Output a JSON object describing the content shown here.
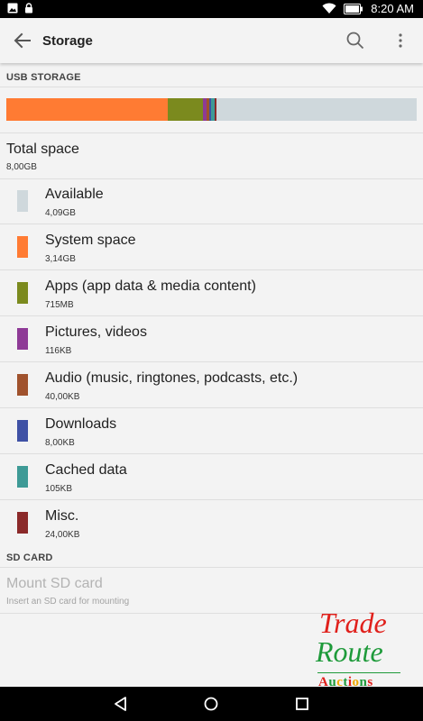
{
  "status_bar": {
    "time": "8:20 AM",
    "icons": [
      "image-notification-icon",
      "lock-icon",
      "wifi-icon",
      "battery-icon"
    ]
  },
  "toolbar": {
    "title": "Storage",
    "icons": [
      "back-arrow-icon",
      "search-icon",
      "more-vert-icon"
    ]
  },
  "usb_storage": {
    "header": "USB STORAGE",
    "total": {
      "label": "Total space",
      "value": "8,00GB"
    },
    "items": [
      {
        "label": "Available",
        "value": "4,09GB",
        "color": "#cfd8dc",
        "fraction": 0.511
      },
      {
        "label": "System space",
        "value": "3,14GB",
        "color": "#ff7b33",
        "fraction": 0.3925
      },
      {
        "label": "Apps (app data & media content)",
        "value": "715MB",
        "color": "#7b8a1e",
        "fraction": 0.0873
      },
      {
        "label": "Pictures, videos",
        "value": "116KB",
        "color": "#8e3a96",
        "fraction": 0.008
      },
      {
        "label": "Audio (music, ringtones, podcasts, etc.)",
        "value": "40,00KB",
        "color": "#a0522d",
        "fraction": 0.006
      },
      {
        "label": "Downloads",
        "value": "8,00KB",
        "color": "#3f51a5",
        "fraction": 0.005
      },
      {
        "label": "Cached data",
        "value": "105KB",
        "color": "#3e9a96",
        "fraction": 0.008
      },
      {
        "label": "Misc.",
        "value": "24,00KB",
        "color": "#8b2a2a",
        "fraction": 0.006
      }
    ]
  },
  "sd_card": {
    "header": "SD CARD",
    "mount_label": "Mount SD card",
    "mount_summary": "Insert an SD card for mounting"
  },
  "watermark": {
    "line1": "Trade",
    "line2": "Route",
    "line3": "Auctions"
  },
  "nav_bar": {
    "icons": [
      "back-nav-icon",
      "home-nav-icon",
      "recents-nav-icon"
    ]
  }
}
